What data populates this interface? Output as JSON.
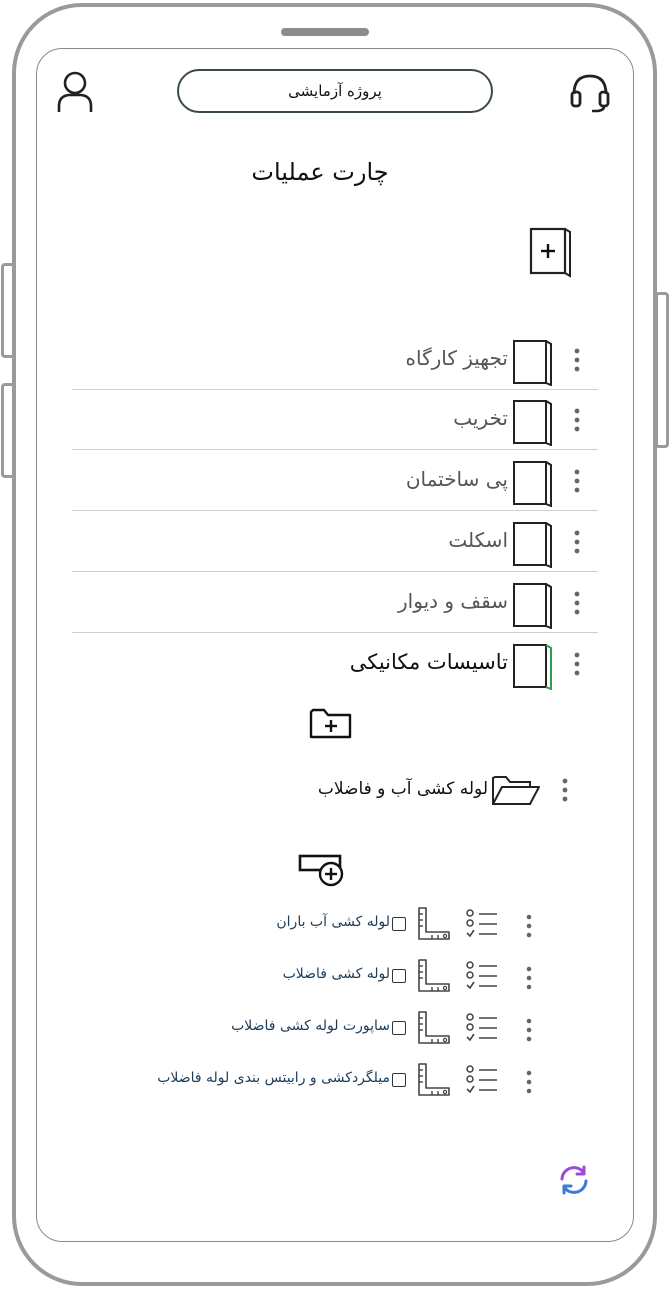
{
  "header": {
    "project_name": "پروژه آزمایشی"
  },
  "page_title": "چارت عملیات",
  "operations": [
    {
      "label": "تجهیز کارگاه",
      "highlight": false
    },
    {
      "label": "تخریب",
      "highlight": false
    },
    {
      "label": "پی ساختمان",
      "highlight": false
    },
    {
      "label": "اسکلت",
      "highlight": false
    },
    {
      "label": "سقف و دیوار",
      "highlight": false
    },
    {
      "label": "تاسیسات مکانیکی",
      "highlight": true
    }
  ],
  "subfolder": {
    "label": "لوله کشی آب و فاضلاب"
  },
  "tasks": [
    {
      "label": "لوله کشی آب باران",
      "checked": false
    },
    {
      "label": "لوله کشی فاضلاب",
      "checked": false
    },
    {
      "label": "ساپورت لوله کشی فاضلاب",
      "checked": false
    },
    {
      "label": "میلگردکشی و رابیتس بندی لوله فاضلاب",
      "checked": false
    }
  ],
  "icons": {
    "user": "user-icon",
    "support": "headset-icon",
    "add_document": "add-document-icon",
    "add_folder": "add-folder-icon",
    "add_task": "add-task-icon",
    "refresh": "refresh-icon"
  },
  "colors": {
    "frame": "#9a9a9a",
    "text_dark": "#111111",
    "text_muted": "#555555",
    "task_text": "#1c3c5a",
    "highlight_green": "#2e9e4a",
    "refresh_purple": "#9b4bd8",
    "refresh_blue": "#3a7bd5"
  }
}
